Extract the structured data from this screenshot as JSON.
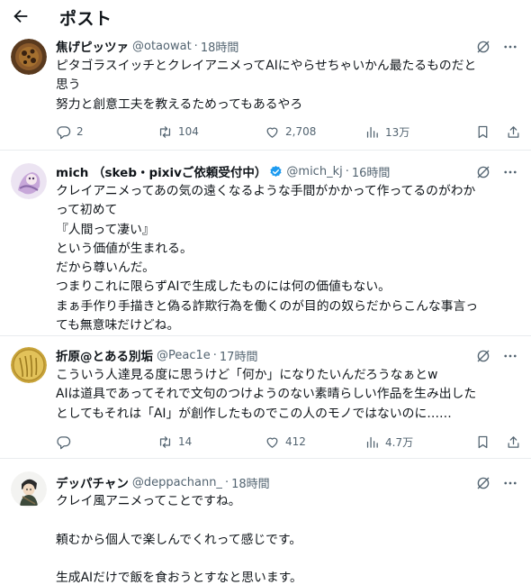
{
  "header": {
    "title": "ポスト"
  },
  "posts": [
    {
      "name": "焦げピッツァ",
      "handle": "@otaowat",
      "dot": "·",
      "time": "18時間",
      "lines": [
        "ピタゴラスイッチとクレイアニメってAIにやらせちゃいかん最たるものだと",
        "思う",
        "努力と創意工夫を教えるためってもあるやろ"
      ],
      "stats": {
        "replies": "2",
        "reposts": "104",
        "likes": "2,708",
        "views": "13万"
      }
    },
    {
      "name": "mich （skeb・pixivご依頼受付中）",
      "handle": "@mich_kj",
      "dot": "·",
      "time": "16時間",
      "verified": true,
      "lines": [
        "クレイアニメってあの気の遠くなるような手間がかかって作ってるのがわか",
        "って初めて",
        "『人間って凄い』",
        "という価値が生まれる。",
        "だから尊いんだ。",
        "つまりこれに限らずAIで生成したものには何の価値もない。",
        "まぁ手作り手描きと偽る詐欺行為を働くのが目的の奴らだからこんな事言っ",
        "ても無意味だけどね。"
      ]
    },
    {
      "name": "折原@とある別垢",
      "handle": "@Peac1e",
      "dot": "·",
      "time": "17時間",
      "lines": [
        "こういう人達見る度に思うけど「何か」になりたいんだろうなぁとw",
        "AIは道具であってそれで文句のつけようのない素晴らしい作品を生み出した",
        "としてもそれは「AI」が創作したものでこの人のモノではないのに……"
      ],
      "stats": {
        "replies": "",
        "reposts": "14",
        "likes": "412",
        "views": "4.7万"
      }
    },
    {
      "name": "デッパチャン",
      "handle": "@deppachann_",
      "dot": "·",
      "time": "18時間",
      "lines": [
        "クレイ風アニメってことですね。",
        "",
        "頼むから個人で楽しんでくれって感じです。",
        "",
        "生成AIだけで飯を食おうとすなと思います。"
      ]
    }
  ],
  "colors": {
    "text": "#0f1419",
    "secondary": "#536471",
    "verified": "#1d9bf0",
    "divider": "#e9ecee"
  },
  "icons": [
    "back-arrow-icon",
    "grok-icon",
    "more-icon",
    "reply-icon",
    "repost-icon",
    "like-icon",
    "views-icon",
    "bookmark-icon",
    "share-icon",
    "verified-badge-icon"
  ]
}
